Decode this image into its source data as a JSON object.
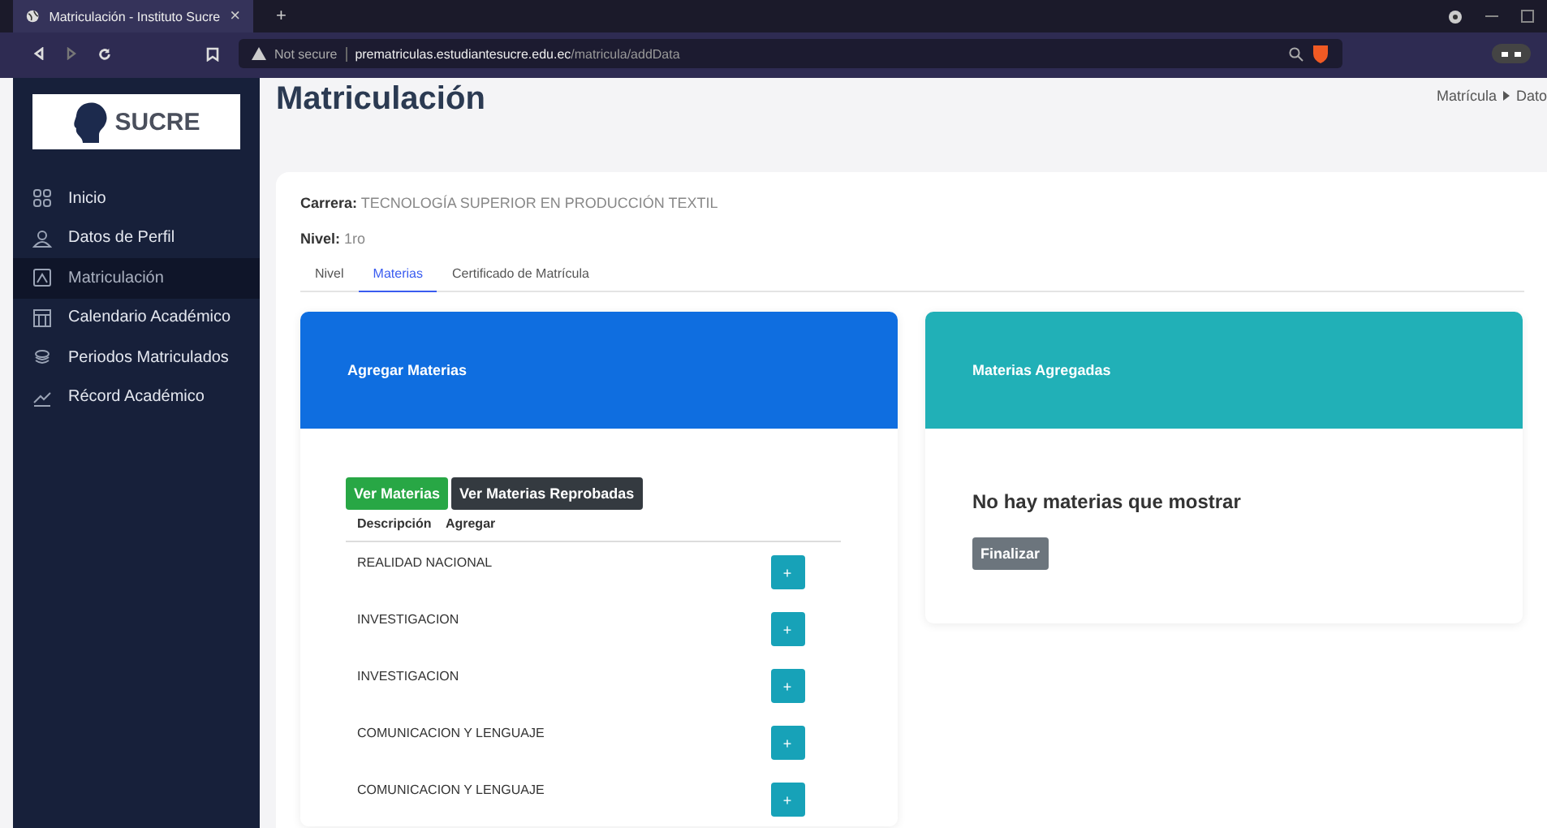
{
  "browser": {
    "tab_title": "Matriculación - Instituto Sucre",
    "tab_close": "×",
    "new_tab": "+",
    "security": "Not secure",
    "url_host": "prematriculas.estudiantesucre.edu.ec",
    "url_path": "/matricula/addData"
  },
  "sidebar": {
    "logo_text": "SUCRE",
    "items": [
      {
        "label": "Inicio",
        "selected": false
      },
      {
        "label": "Datos de Perfil",
        "selected": false
      },
      {
        "label": "Matriculación",
        "selected": true
      },
      {
        "label": "Calendario Académico",
        "selected": false
      },
      {
        "label": "Periodos Matriculados",
        "selected": false
      },
      {
        "label": "Récord Académico",
        "selected": false
      }
    ]
  },
  "page": {
    "title": "Matriculación",
    "breadcrumb": [
      "Matrícula",
      "Dato"
    ]
  },
  "info": {
    "career_label": "Carrera:",
    "career": "TECNOLOGÍA SUPERIOR EN PRODUCCIÓN TEXTIL",
    "level_label": "Nivel:",
    "level": "1ro"
  },
  "tabs": [
    {
      "label": "Nivel",
      "selected": false
    },
    {
      "label": "Materias",
      "selected": true
    },
    {
      "label": "Certificado de Matrícula",
      "selected": false
    }
  ],
  "add_panel": {
    "title": "Agregar Materias",
    "buttons": [
      {
        "label": "Ver Materias",
        "kind": "success"
      },
      {
        "label": "Ver Materias Reprobadas",
        "kind": "dark"
      }
    ],
    "columns": [
      "Descripción",
      "Agregar"
    ],
    "rows": [
      {
        "description": "REALIDAD NACIONAL",
        "action": "+"
      },
      {
        "description": "INVESTIGACION",
        "action": "+"
      },
      {
        "description": "INVESTIGACION",
        "action": "+"
      },
      {
        "description": "COMUNICACION Y LENGUAJE",
        "action": "+"
      },
      {
        "description": "COMUNICACION Y LENGUAJE",
        "action": "+"
      }
    ]
  },
  "added_panel": {
    "title": "Materias Agregadas",
    "empty_message": "No hay materias que mostrar",
    "button": "Finalizar"
  }
}
